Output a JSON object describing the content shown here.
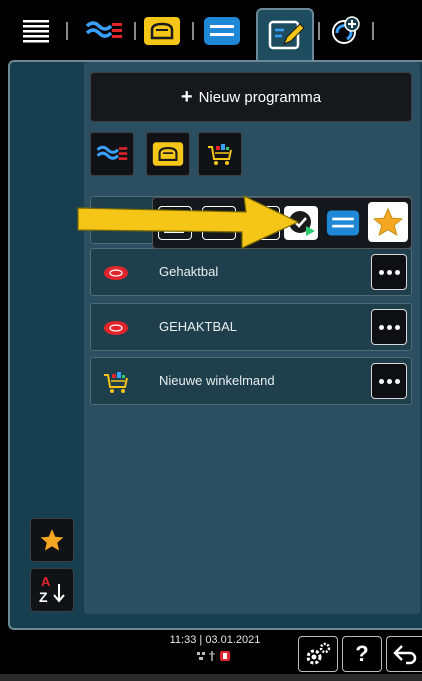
{
  "tabs": [
    {
      "name": "menu",
      "icon": "hamburger-list-icon"
    },
    {
      "name": "meat-category",
      "icon": "meat-steam-icon"
    },
    {
      "name": "baking-category",
      "icon": "bread-icon"
    },
    {
      "name": "side-dish-category",
      "icon": "tray-icon"
    },
    {
      "name": "edit-programs",
      "icon": "edit-pencil-icon",
      "active": true
    },
    {
      "name": "intelligent-cooking",
      "icon": "spiral-plus-icon"
    }
  ],
  "new_program": {
    "label": "Nieuw programma",
    "plus": "+"
  },
  "filters": [
    {
      "name": "filter-meat",
      "icon": "meat-steam-icon"
    },
    {
      "name": "filter-bread",
      "icon": "bread-icon"
    },
    {
      "name": "filter-basket",
      "icon": "basket-icon"
    }
  ],
  "list": [
    {
      "label": "Gehaktbal",
      "icon": "meat-icon"
    },
    {
      "label": "GEHAKTBAL",
      "icon": "meat-icon"
    },
    {
      "label": "Nieuwe winkelmand",
      "icon": "basket-icon"
    }
  ],
  "popup_actions": [
    {
      "name": "edit",
      "icon": "edit-icon"
    },
    {
      "name": "copy",
      "icon": "copy-icon"
    },
    {
      "name": "delete",
      "icon": "delete-icon"
    },
    {
      "name": "start-timer",
      "icon": "clock-play-icon"
    },
    {
      "name": "category",
      "icon": "tray-icon"
    },
    {
      "name": "favorite",
      "icon": "star-icon"
    }
  ],
  "side": {
    "sort_top": "A",
    "sort_bottom": "Z"
  },
  "status": {
    "time": "11:33",
    "date": "03.01.2021",
    "separator": "|"
  },
  "colors": {
    "accent_blue": "#1e88d6",
    "yellow": "#f5c518",
    "meat_red": "#c0392b",
    "panel": "#173f4f"
  }
}
